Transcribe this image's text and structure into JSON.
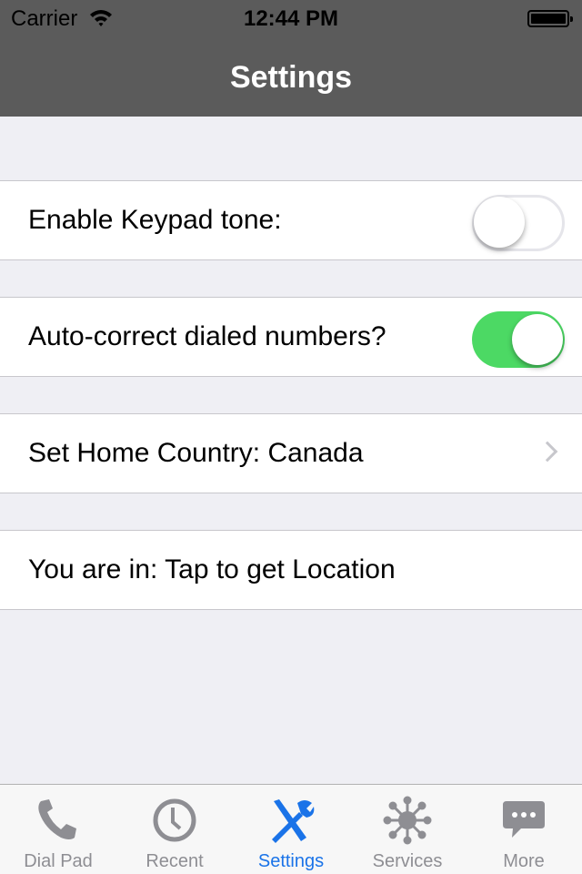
{
  "status_bar": {
    "carrier": "Carrier",
    "time": "12:44 PM",
    "wifi_icon": "wifi-icon",
    "battery_icon": "battery-icon"
  },
  "nav": {
    "title": "Settings"
  },
  "settings": [
    {
      "label": "Enable Keypad tone:",
      "type": "switch",
      "value": false
    },
    {
      "label": "Auto-correct dialed numbers?",
      "type": "switch",
      "value": true
    },
    {
      "label": "Set Home Country: Canada",
      "type": "disclosure"
    },
    {
      "label": "You are in:  Tap to get Location",
      "type": "action"
    }
  ],
  "colors": {
    "accent": "#1a73e8",
    "switch_on": "#4cd964",
    "nav_bg": "#5b5b5b",
    "page_bg": "#efeff4"
  },
  "tabs": [
    {
      "label": "Dial Pad",
      "icon": "phone-icon",
      "active": false
    },
    {
      "label": "Recent",
      "icon": "clock-icon",
      "active": false
    },
    {
      "label": "Settings",
      "icon": "tools-icon",
      "active": true
    },
    {
      "label": "Services",
      "icon": "network-icon",
      "active": false
    },
    {
      "label": "More",
      "icon": "chat-bubble-icon",
      "active": false
    }
  ]
}
